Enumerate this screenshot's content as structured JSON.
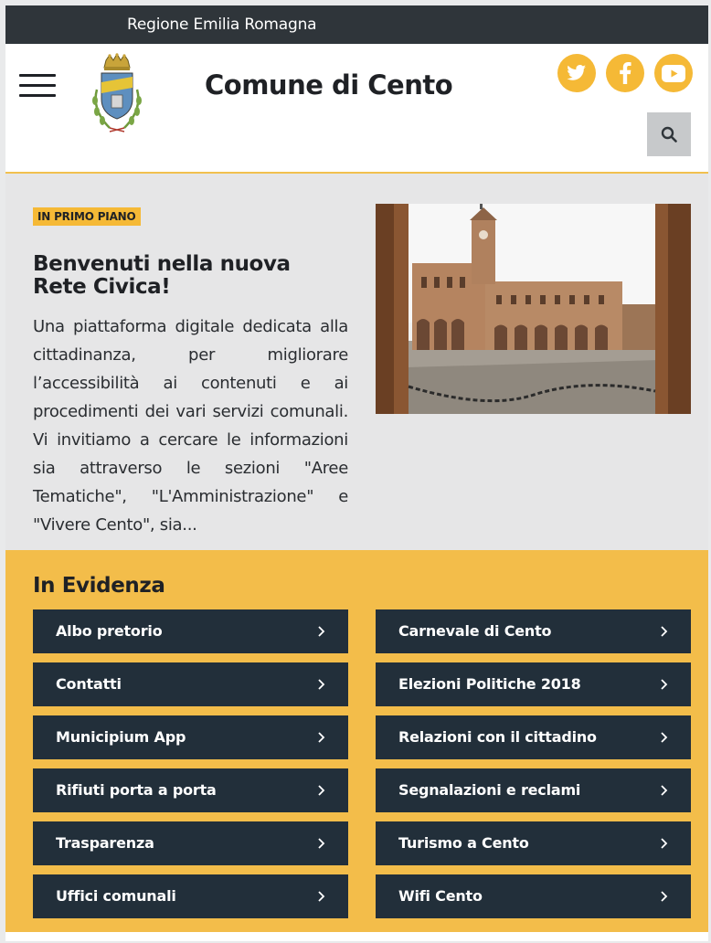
{
  "topbar": {
    "region": "Regione Emilia Romagna"
  },
  "header": {
    "site_title": "Comune di Cento",
    "icons": [
      "menu-icon",
      "twitter-icon",
      "facebook-icon",
      "youtube-icon",
      "search-icon"
    ]
  },
  "colors": {
    "dark": "#2f353a",
    "accent": "#f5b936",
    "tile": "#222f3a",
    "band": "#f3bd4a"
  },
  "feature": {
    "badge": "IN PRIMO PIANO",
    "title": "Benvenuti nella nuova Rete Civica!",
    "text": "Una piattaforma digitale dedicata alla cittadinanza, per migliorare l’accessibilità ai contenuti e ai procedimenti dei vari servizi comunali. Vi invitiamo a cercare le informazioni sia attraverso le sezioni \"Aree Tematiche\", \"L'Amministrazione\" e \"Vivere Cento\", sia..."
  },
  "evidenza": {
    "title": "In Evidenza",
    "items": [
      "Albo pretorio",
      "Carnevale di Cento",
      "Contatti",
      "Elezioni Politiche 2018",
      "Municipium App",
      "Relazioni con il cittadino",
      "Rifiuti porta a porta",
      "Segnalazioni e reclami",
      "Trasparenza",
      "Turismo a Cento",
      "Uffici comunali",
      "Wifi Cento"
    ]
  }
}
